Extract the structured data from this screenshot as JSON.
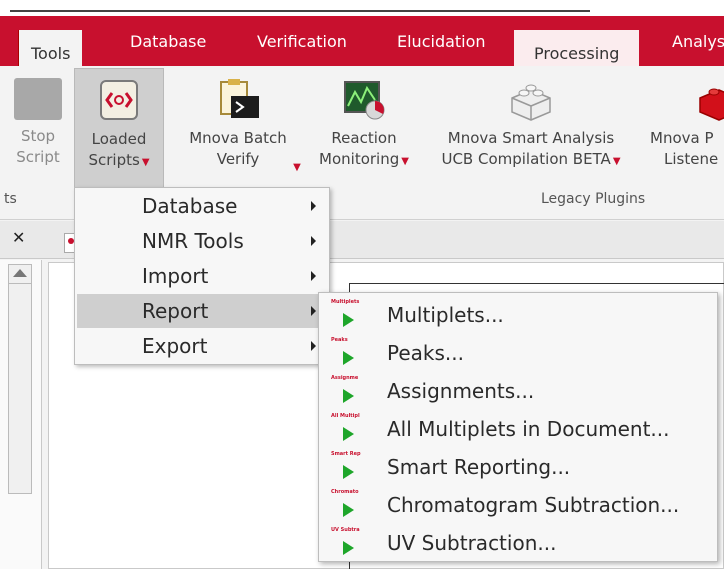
{
  "tabs": [
    {
      "label": "Tools"
    },
    {
      "label": "Database"
    },
    {
      "label": "Verification"
    },
    {
      "label": "Elucidation"
    },
    {
      "label": "Processing"
    },
    {
      "label": "Analys"
    }
  ],
  "ribbon": {
    "stop_script": {
      "line1": "Stop",
      "line2": "Script"
    },
    "loaded_scripts": {
      "line1": "Loaded",
      "line2": "Scripts"
    },
    "batch_verify": {
      "line1": "Mnova Batch",
      "line2": "Verify"
    },
    "reaction_monitoring": {
      "line1": "Reaction",
      "line2": "Monitoring"
    },
    "smart_analysis": {
      "line1": "Mnova Smart Analysis",
      "line2": "UCB Compilation BETA"
    },
    "mnova_p": {
      "line1": "Mnova P",
      "line2": "Listene"
    },
    "group_left": "ts",
    "group_legacy": "Legacy Plugins"
  },
  "menu": {
    "items": [
      {
        "label": "Database"
      },
      {
        "label": "NMR Tools"
      },
      {
        "label": "Import"
      },
      {
        "label": "Report"
      },
      {
        "label": "Export"
      }
    ]
  },
  "submenu": {
    "items": [
      {
        "label": "Multiplets...",
        "icon_text": "Multiplets"
      },
      {
        "label": "Peaks...",
        "icon_text": "Peaks"
      },
      {
        "label": "Assignments...",
        "icon_text": "Assignme"
      },
      {
        "label": "All Multiplets in Document...",
        "icon_text": "All Multipl"
      },
      {
        "label": "Smart Reporting...",
        "icon_text": "Smart Rep"
      },
      {
        "label": "Chromatogram Subtraction...",
        "icon_text": "Chromato"
      },
      {
        "label": "UV Subtraction...",
        "icon_text": "UV Subtra"
      }
    ]
  },
  "colors": {
    "accent": "#c8102e",
    "play": "#1ea62a",
    "highlight": "#cfcfcf"
  }
}
